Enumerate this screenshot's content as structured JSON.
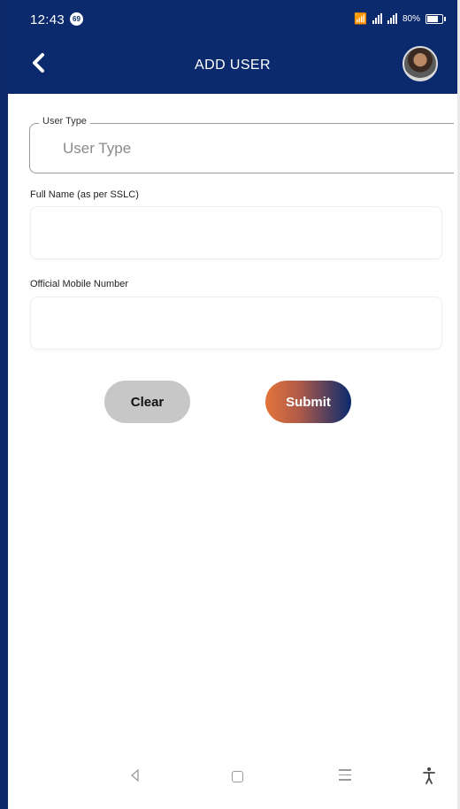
{
  "colors": {
    "primary": "#0a2a6d",
    "submit_start": "#e2743a",
    "clear_bg": "#c7c7c7"
  },
  "status_bar": {
    "time": "12:43",
    "notification_badge": "69",
    "battery": "80%"
  },
  "app_bar": {
    "title": "ADD USER",
    "back_icon": "chevron-left-icon",
    "avatar_icon": "profile-avatar"
  },
  "form": {
    "user_type": {
      "label": "User Type",
      "placeholder": "User Type"
    },
    "full_name": {
      "label": "Full Name (as per SSLC)",
      "value": ""
    },
    "mobile": {
      "label": "Official Mobile Number",
      "value": ""
    }
  },
  "buttons": {
    "clear": "Clear",
    "submit": "Submit"
  },
  "nav_bar": {
    "icons": [
      "back-triangle-icon",
      "home-square-icon",
      "menu-lines-icon",
      "accessibility-icon"
    ]
  }
}
